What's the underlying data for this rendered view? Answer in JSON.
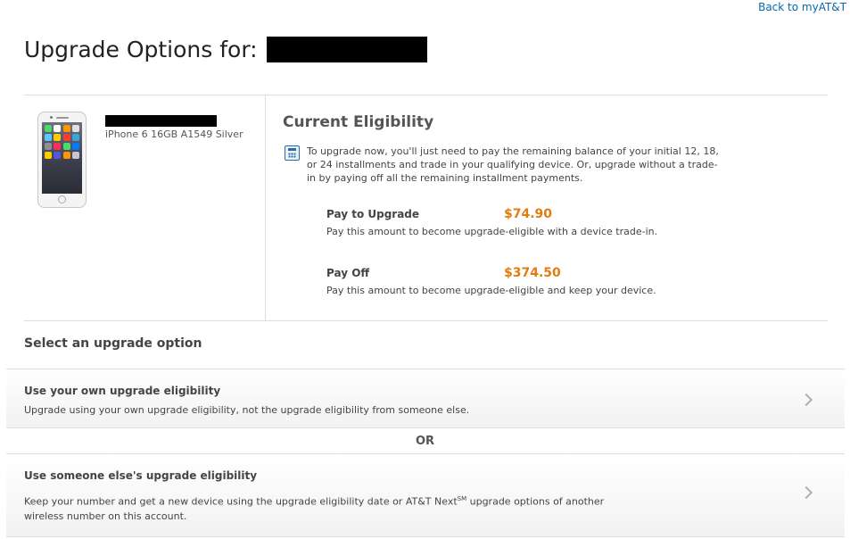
{
  "header": {
    "back_link": "Back to myAT&T",
    "title": "Upgrade Options for:"
  },
  "device": {
    "name": "iPhone 6 16GB A1549 Silver",
    "image_alt": "iPhone 6 Silver"
  },
  "eligibility": {
    "title": "Current Eligibility",
    "icon": "calculator-icon",
    "description": "To upgrade now, you'll just need to pay the remaining balance of your initial 12, 18, or 24 installments and trade in your qualifying device. Or, upgrade without a trade-in by paying off all the remaining installment payments.",
    "pay_to_upgrade": {
      "label": "Pay to Upgrade",
      "amount": "$74.90",
      "description": "Pay this amount to become upgrade-eligible with a device trade-in."
    },
    "pay_off": {
      "label": "Pay Off",
      "amount": "$374.50",
      "description": "Pay this amount to become upgrade-eligible and keep your device."
    }
  },
  "upgrade_options": {
    "heading": "Select an upgrade option",
    "own": {
      "title": "Use your own upgrade eligibility",
      "description": "Upgrade using your own upgrade eligibility, not the upgrade eligibility from someone else."
    },
    "separator": "OR",
    "other": {
      "title": "Use someone else's upgrade eligibility",
      "description_pre": "Keep your number and get a new device using the upgrade eligibility date or AT&T Next",
      "description_sup": "SM",
      "description_post": " upgrade options of another wireless number on this account."
    }
  },
  "colors": {
    "accent_price": "#e07c10",
    "link": "#0568ae"
  }
}
